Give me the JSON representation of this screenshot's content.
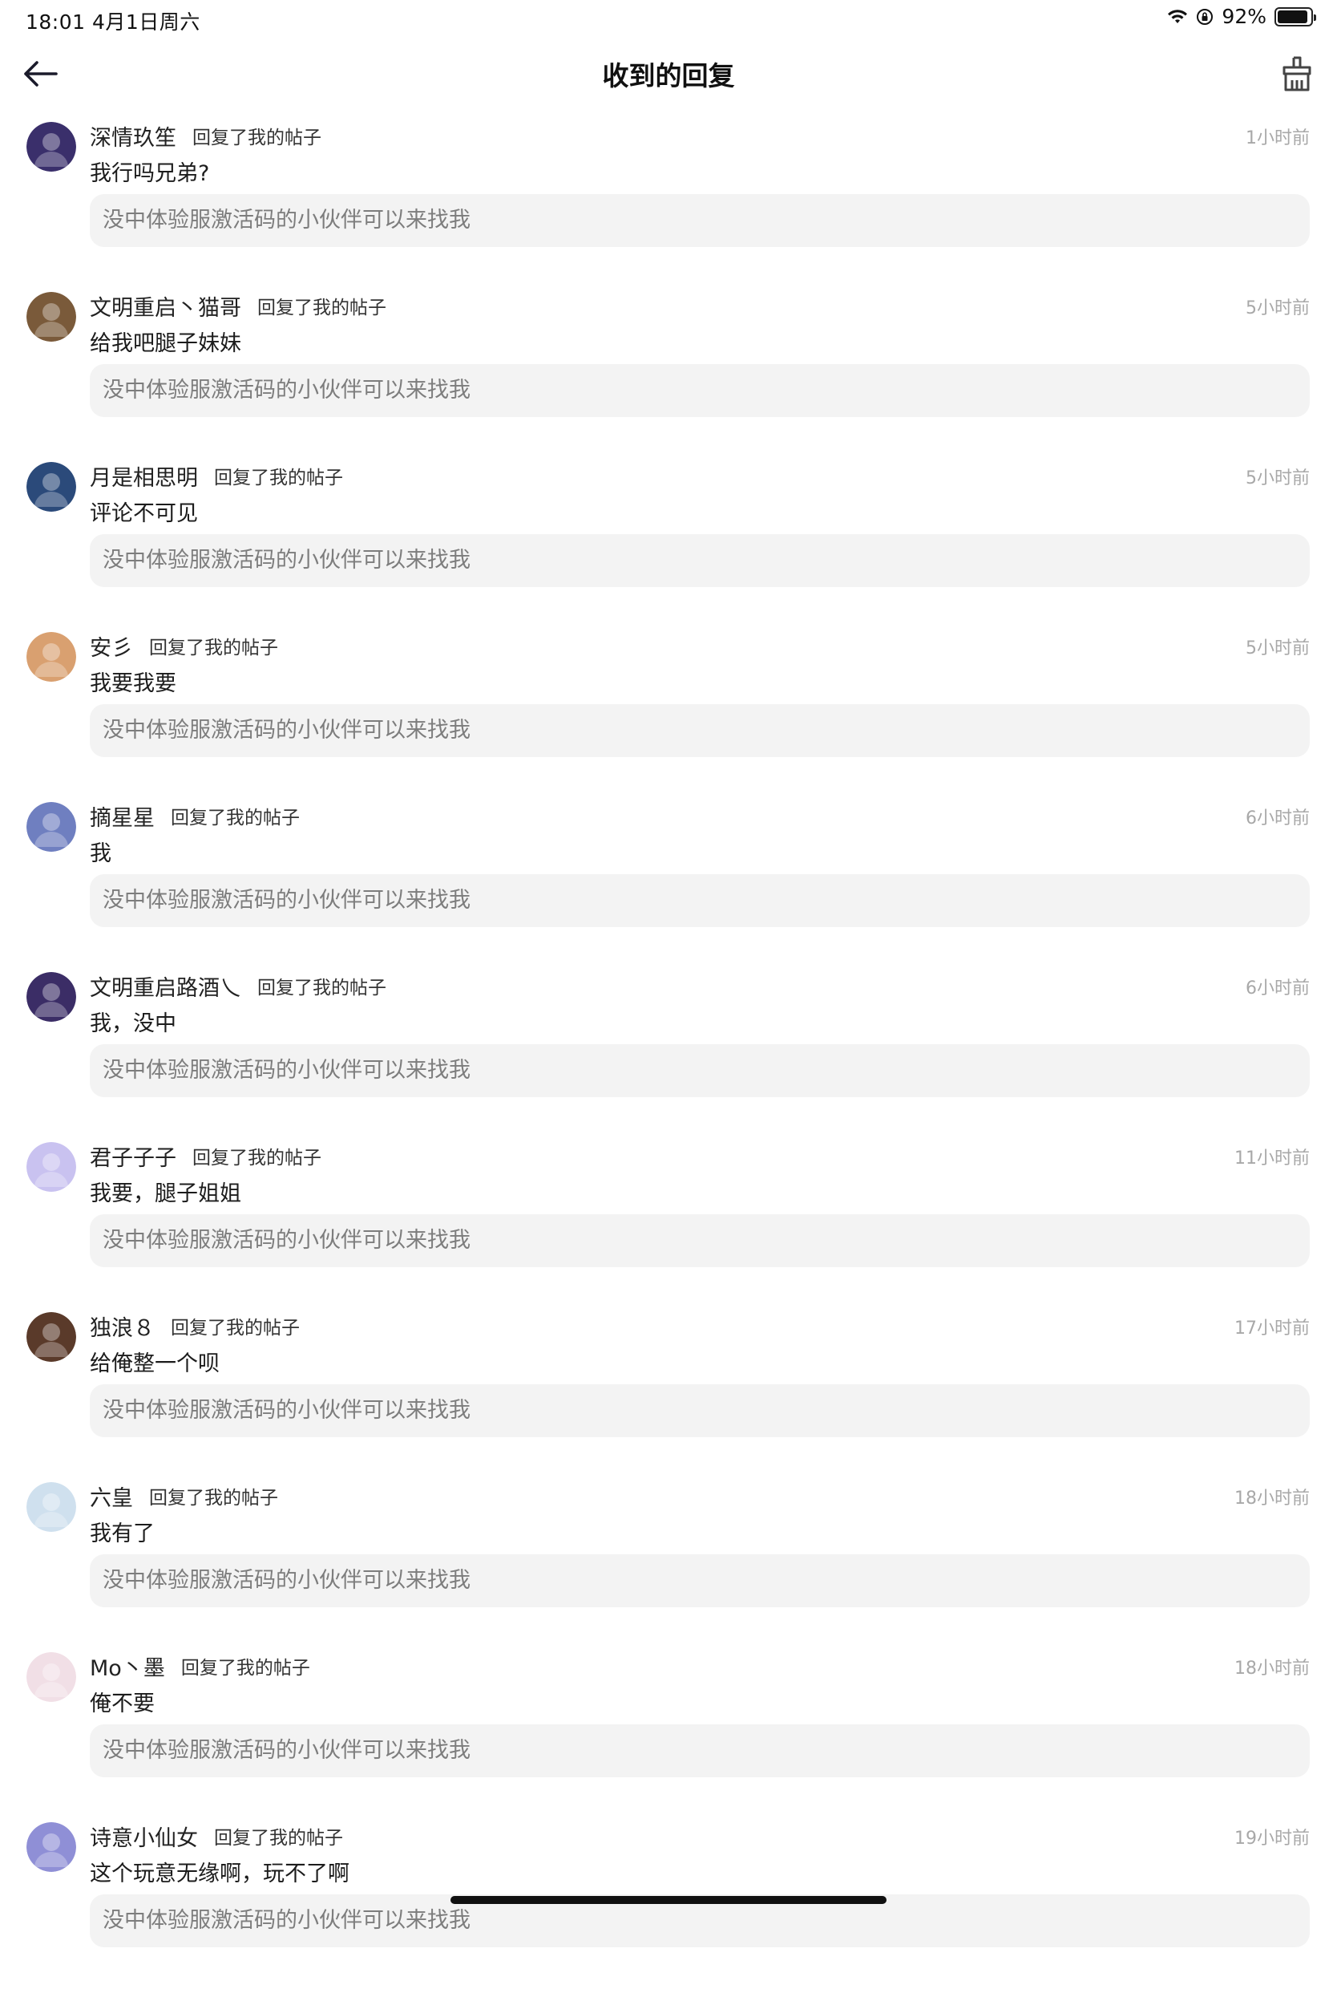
{
  "status_bar": {
    "time": "18:01  4月1日周六",
    "battery_percent": "92%",
    "battery_level": 0.92,
    "icons": [
      "wifi-icon",
      "orientation-lock-icon",
      "battery-icon"
    ]
  },
  "nav": {
    "title": "收到的回复",
    "back_icon": "back-arrow-icon",
    "clean_icon": "broom-clean-icon"
  },
  "replies": [
    {
      "user": "深情玖笙",
      "action": "回复了我的帖子",
      "time": "1小时前",
      "reply": "我行吗兄弟?",
      "quote": "没中体验服激活码的小伙伴可以来找我",
      "avatar_color": "#3a2f6b"
    },
    {
      "user": "文明重启丶猫哥",
      "action": "回复了我的帖子",
      "time": "5小时前",
      "reply": "给我吧腿子妹妹",
      "quote": "没中体验服激活码的小伙伴可以来找我",
      "avatar_color": "#7a5a3a"
    },
    {
      "user": "月是相思明",
      "action": "回复了我的帖子",
      "time": "5小时前",
      "reply": "评论不可见",
      "quote": "没中体验服激活码的小伙伴可以来找我",
      "avatar_color": "#2b4a7a"
    },
    {
      "user": "安彡",
      "action": "回复了我的帖子",
      "time": "5小时前",
      "reply": "我要我要",
      "quote": "没中体验服激活码的小伙伴可以来找我",
      "avatar_color": "#d9a070"
    },
    {
      "user": "摘星星",
      "action": "回复了我的帖子",
      "time": "6小时前",
      "reply": "我",
      "quote": "没中体验服激活码的小伙伴可以来找我",
      "avatar_color": "#6f7fc0"
    },
    {
      "user": "文明重启路酒乀",
      "action": "回复了我的帖子",
      "time": "6小时前",
      "reply": "我，没中",
      "quote": "没中体验服激活码的小伙伴可以来找我",
      "avatar_color": "#3b2d66"
    },
    {
      "user": "君子子子",
      "action": "回复了我的帖子",
      "time": "11小时前",
      "reply": "我要，腿子姐姐",
      "quote": "没中体验服激活码的小伙伴可以来找我",
      "avatar_color": "#c9c2f0"
    },
    {
      "user": "独浪８",
      "action": "回复了我的帖子",
      "time": "17小时前",
      "reply": "给俺整一个呗",
      "quote": "没中体验服激活码的小伙伴可以来找我",
      "avatar_color": "#5a3a2a"
    },
    {
      "user": "六皇",
      "action": "回复了我的帖子",
      "time": "18小时前",
      "reply": "我有了",
      "quote": "没中体验服激活码的小伙伴可以来找我",
      "avatar_color": "#cfe0ee"
    },
    {
      "user": "Mo丶墨",
      "action": "回复了我的帖子",
      "time": "18小时前",
      "reply": "俺不要",
      "quote": "没中体验服激活码的小伙伴可以来找我",
      "avatar_color": "#f1dfe6"
    },
    {
      "user": "诗意小仙女",
      "action": "回复了我的帖子",
      "time": "19小时前",
      "reply": "这个玩意无缘啊，玩不了啊",
      "quote": "没中体验服激活码的小伙伴可以来找我",
      "avatar_color": "#8f8fd6"
    }
  ]
}
